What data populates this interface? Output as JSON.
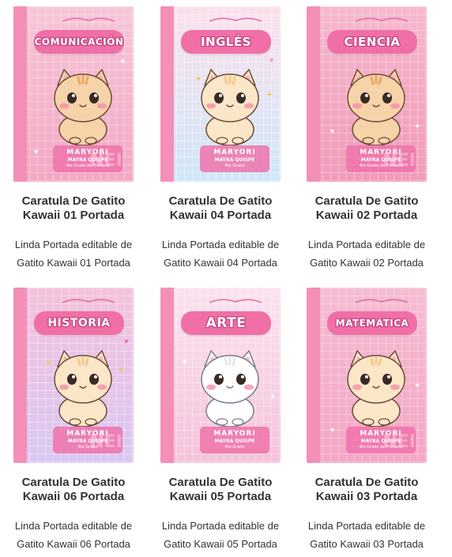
{
  "cards": [
    {
      "subject": "COMUNICACIÓN",
      "title_line1": "Caratula De Gatito",
      "title_line2": "Kawaii 01 Portada",
      "desc_line1": "Linda Portada editable de",
      "desc_line2": "Gatito Kawaii 01 Portada",
      "name": "MARYORI",
      "surname": "MAYRA QUISPE",
      "grade": "4to Grado de Primaria",
      "watermark": "NEI",
      "cat_style": "tabby",
      "colors": {
        "bg_top": "#f7c6d8",
        "bg_bottom": "#f4a7c4",
        "spine": "#f48fb8",
        "banner": "#f06fa6"
      }
    },
    {
      "subject": "INGLÉS",
      "title_line1": "Caratula De Gatito",
      "title_line2": "Kawaii 04 Portada",
      "desc_line1": "Linda Portada editable de",
      "desc_line2": "Gatito Kawaii 04 Portada",
      "name": "MARYORI",
      "surname": "MAYRA QUISPE",
      "grade": "4to Grado",
      "watermark": "",
      "cat_style": "cream",
      "colors": {
        "bg_top": "#fde1ec",
        "bg_bottom": "#cfe7f7",
        "spine": "#f48fb8",
        "banner": "#f06fa6"
      }
    },
    {
      "subject": "CIENCIA",
      "title_line1": "Caratula De Gatito",
      "title_line2": "Kawaii 02 Portada",
      "desc_line1": "Linda Portada editable de",
      "desc_line2": "Gatito Kawaii 02 Portada",
      "name": "MARYORI",
      "surname": "MAYRA QUISPE",
      "grade": "4to Grado de Primaria",
      "watermark": "NEI",
      "cat_style": "tabby",
      "colors": {
        "bg_top": "#f6b8cc",
        "bg_bottom": "#f29ab9",
        "spine": "#f48fb8",
        "banner": "#f06fa6"
      }
    },
    {
      "subject": "HISTORIA",
      "title_line1": "Caratula De Gatito",
      "title_line2": "Kawaii 06 Portada",
      "desc_line1": "Linda Portada editable de",
      "desc_line2": "Gatito Kawaii 06 Portada",
      "name": "MARYORI",
      "surname": "MAYRA QUISPE",
      "grade": "4to Grado",
      "watermark": "NEI",
      "cat_style": "cream",
      "colors": {
        "bg_top": "#f5c2dc",
        "bg_bottom": "#d9c8f2",
        "spine": "#f48fb8",
        "banner": "#f06fa6"
      }
    },
    {
      "subject": "ARTE",
      "title_line1": "Caratula De Gatito",
      "title_line2": "Kawaii 05 Portada",
      "desc_line1": "Linda Portada editable de",
      "desc_line2": "Gatito Kawaii 05 Portada",
      "name": "MARYORI",
      "surname": "MAYRA QUISPE",
      "grade": "4to Grado",
      "watermark": "",
      "cat_style": "white",
      "colors": {
        "bg_top": "#fbe3ef",
        "bg_bottom": "#f5c3dc",
        "spine": "#f48fb8",
        "banner": "#f06fa6"
      }
    },
    {
      "subject": "MATEMÁTICA",
      "title_line1": "Caratula De Gatito",
      "title_line2": "Kawaii 03 Portada",
      "desc_line1": "Linda Portada editable de",
      "desc_line2": "Gatito Kawaii 03 Portada",
      "name": "MARYORI",
      "surname": "MAYRA QUISPE",
      "grade": "4to Grado de Primaria",
      "watermark": "NEI",
      "cat_style": "cream",
      "colors": {
        "bg_top": "#f6bcd2",
        "bg_bottom": "#f4a6c4",
        "spine": "#f48fb8",
        "banner": "#f06fa6"
      }
    }
  ]
}
